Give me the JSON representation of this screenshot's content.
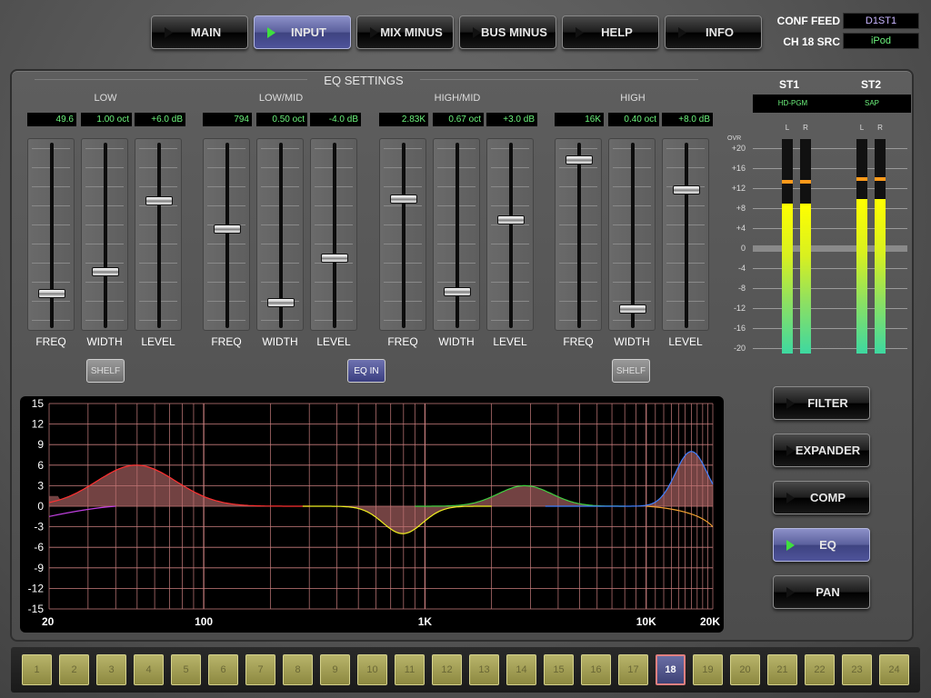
{
  "nav": {
    "buttons": [
      {
        "label": "MAIN",
        "active": false
      },
      {
        "label": "INPUT",
        "active": true
      },
      {
        "label": "MIX MINUS",
        "active": false
      },
      {
        "label": "BUS MINUS",
        "active": false
      },
      {
        "label": "HELP",
        "active": false
      },
      {
        "label": "INFO",
        "active": false
      }
    ]
  },
  "header": {
    "conf_feed_label": "CONF FEED",
    "conf_feed_value": "D1ST1",
    "ch_src_label": "CH 18 SRC",
    "ch_src_value": "iPod"
  },
  "eq": {
    "title": "EQ SETTINGS",
    "bands": [
      {
        "name": "LOW",
        "freq": "49.6",
        "width": "1.00 oct",
        "level": "+6.0 dB",
        "freq_pos": 0.82,
        "width_pos": 0.7,
        "level_pos": 0.3,
        "button": "SHELF",
        "button_on": false
      },
      {
        "name": "LOW/MID",
        "freq": "794",
        "width": "0.50 oct",
        "level": "-4.0 dB",
        "freq_pos": 0.46,
        "width_pos": 0.87,
        "level_pos": 0.62,
        "button": "EQ IN",
        "button_on": true
      },
      {
        "name": "HIGH/MID",
        "freq": "2.83K",
        "width": "0.67 oct",
        "level": "+3.0 dB",
        "freq_pos": 0.29,
        "width_pos": 0.81,
        "level_pos": 0.41,
        "button": "",
        "button_on": false
      },
      {
        "name": "HIGH",
        "freq": "16K",
        "width": "0.40 oct",
        "level": "+8.0 dB",
        "freq_pos": 0.07,
        "width_pos": 0.91,
        "level_pos": 0.24,
        "button": "SHELF",
        "button_on": false
      }
    ],
    "fader_labels": [
      "FREQ",
      "WIDTH",
      "LEVEL"
    ]
  },
  "meters": {
    "channels": [
      {
        "name": "ST1",
        "source": "HD-PGM",
        "left": 0.7,
        "right": 0.7,
        "peak_l": 0.81,
        "peak_r": 0.81
      },
      {
        "name": "ST2",
        "source": "SAP",
        "left": 0.72,
        "right": 0.72,
        "peak_l": 0.82,
        "peak_r": 0.82
      }
    ],
    "lr": [
      "L",
      "R"
    ],
    "ovr": "OVR",
    "scale": [
      "+20",
      "+16",
      "+12",
      "+8",
      "+4",
      "0",
      "-4",
      "-8",
      "-12",
      "-16",
      "-20"
    ]
  },
  "graph": {
    "y_ticks": [
      "15",
      "12",
      "9",
      "6",
      "3",
      "0",
      "-3",
      "-6",
      "-9",
      "-12",
      "-15"
    ],
    "x_ticks": [
      "20",
      "100",
      "1K",
      "10K",
      "20K"
    ]
  },
  "side": {
    "buttons": [
      {
        "label": "FILTER",
        "active": false
      },
      {
        "label": "EXPANDER",
        "active": false
      },
      {
        "label": "COMP",
        "active": false
      },
      {
        "label": "EQ",
        "active": true
      },
      {
        "label": "PAN",
        "active": false
      }
    ]
  },
  "channels": {
    "labels": [
      "1",
      "2",
      "3",
      "4",
      "5",
      "6",
      "7",
      "8",
      "9",
      "10",
      "11",
      "12",
      "13",
      "14",
      "15",
      "16",
      "17",
      "18",
      "19",
      "20",
      "21",
      "22",
      "23",
      "24"
    ],
    "selected": "18"
  }
}
